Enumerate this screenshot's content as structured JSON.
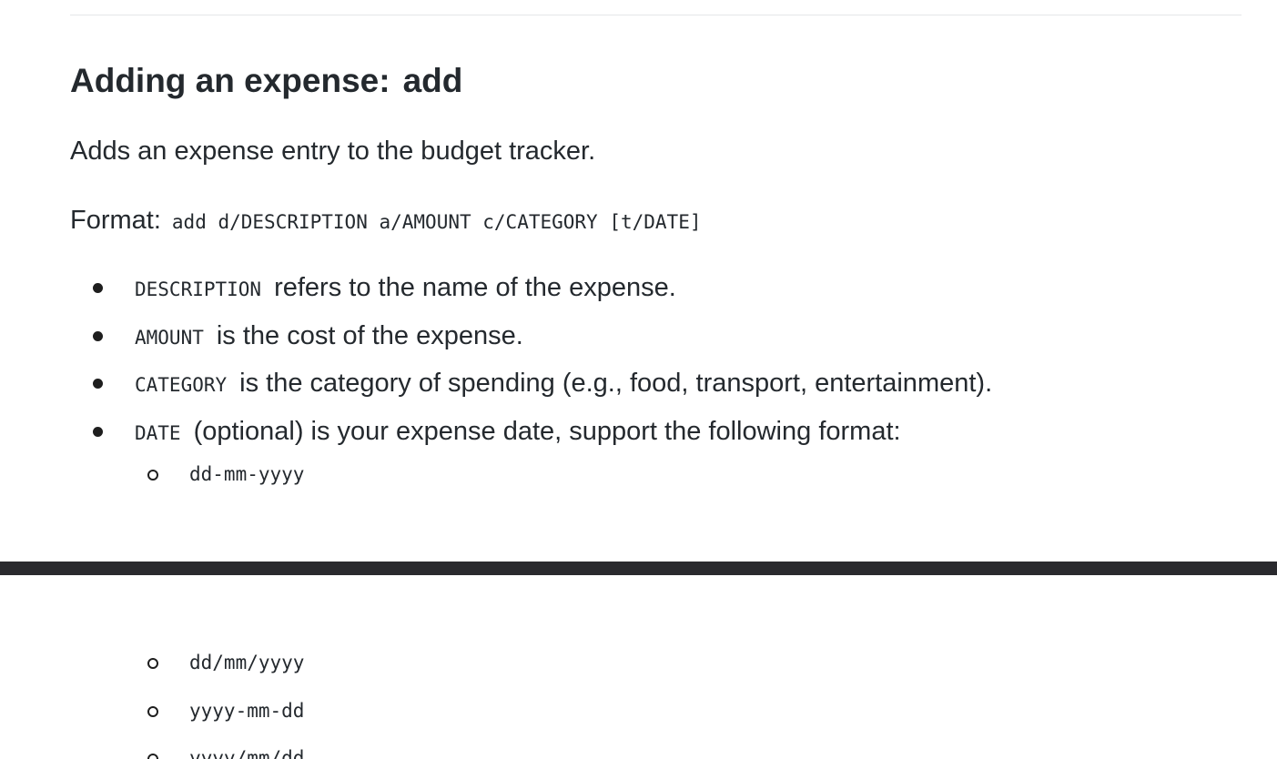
{
  "section": {
    "heading_text": "Adding an expense:",
    "heading_command": "add",
    "description": "Adds an expense entry to the budget tracker.",
    "format_label": "Format:",
    "format_code": "add d/DESCRIPTION a/AMOUNT c/CATEGORY [t/DATE]",
    "bullets": [
      {
        "code": "DESCRIPTION",
        "text": "refers to the name of the expense."
      },
      {
        "code": "AMOUNT",
        "text": "is the cost of the expense."
      },
      {
        "code": "CATEGORY",
        "text": "is the category of spending (e.g., food, transport, entertainment)."
      },
      {
        "code": "DATE",
        "text": "(optional) is your expense date, support the following format:"
      }
    ],
    "date_formats": [
      "dd-mm-yyyy",
      "dd/mm/yyyy",
      "yyyy-mm-dd",
      "yyyy/mm/dd"
    ]
  }
}
